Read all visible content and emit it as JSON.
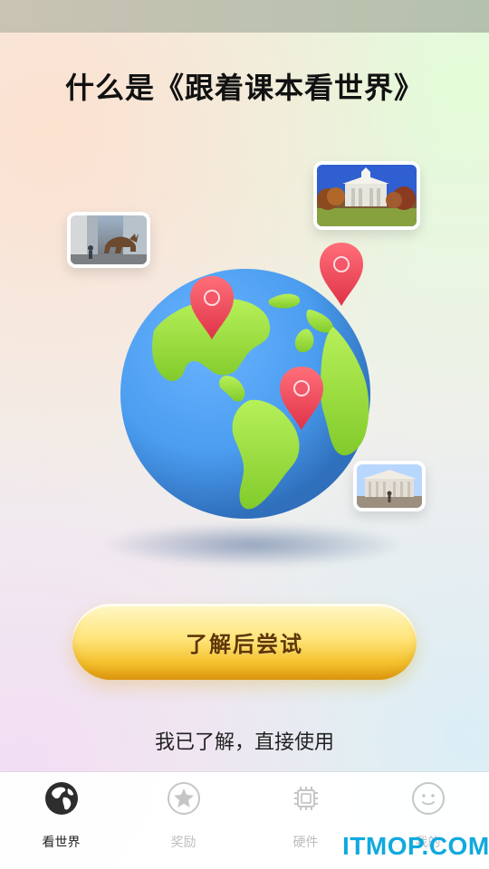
{
  "header": {
    "title": "什么是《跟着课本看世界》"
  },
  "hero": {
    "photo_bull_icon": "wall-street-bull-photo-icon",
    "photo_hall_icon": "harvard-hall-photo-icon",
    "photo_columbia_icon": "columbia-library-photo-icon",
    "globe_icon": "globe-icon",
    "marker_icon": "location-pin-icon",
    "colors": {
      "ocean": "#4b9df0",
      "land": "#9be13f",
      "pin": "#f24e61",
      "cta": "#f4c12d",
      "cta_text": "#5f3606"
    }
  },
  "actions": {
    "primary_label": "了解后尝试",
    "secondary_label": "我已了解，直接使用"
  },
  "tabbar": {
    "items": [
      {
        "label": "看世界",
        "icon": "globe-icon",
        "active": true
      },
      {
        "label": "奖励",
        "icon": "star-icon",
        "active": false
      },
      {
        "label": "硬件",
        "icon": "chip-icon",
        "active": false
      },
      {
        "label": "我的",
        "icon": "smile-icon",
        "active": false
      }
    ]
  },
  "watermark": {
    "text": "ITMOP.COM"
  }
}
